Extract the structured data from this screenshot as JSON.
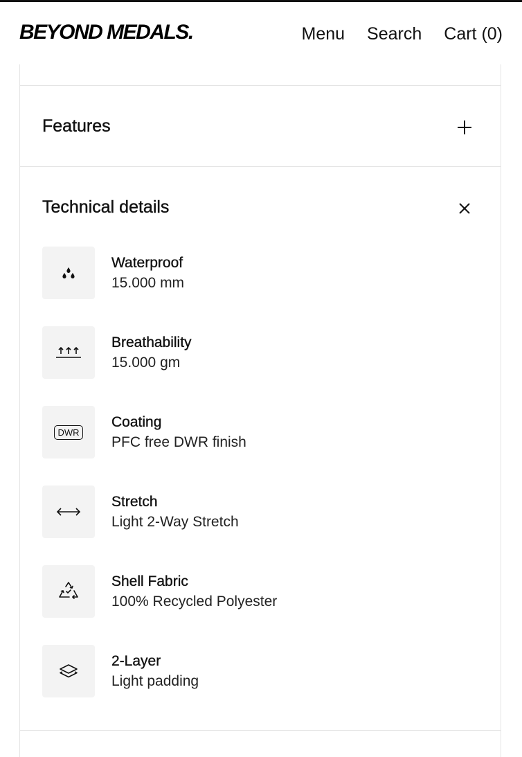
{
  "header": {
    "logo": "BEYOND MEDALS.",
    "nav": {
      "menu": "Menu",
      "search": "Search",
      "cart": "Cart (0)"
    }
  },
  "sections": {
    "features": {
      "title": "Features",
      "toggle_icon": "plus-icon"
    },
    "technical": {
      "title": "Technical details",
      "toggle_icon": "close-icon"
    }
  },
  "specs": [
    {
      "icon": "water-drops-icon",
      "title": "Waterproof",
      "value": "15.000 mm"
    },
    {
      "icon": "breathability-arrows-icon",
      "title": "Breathability",
      "value": "15.000 gm"
    },
    {
      "icon": "dwr-icon",
      "icon_text": "DWR",
      "title": "Coating",
      "value": "PFC free DWR finish"
    },
    {
      "icon": "horizontal-arrows-icon",
      "title": "Stretch",
      "value": "Light 2-Way Stretch"
    },
    {
      "icon": "recycle-icon",
      "title": "Shell Fabric",
      "value": "100% Recycled Polyester"
    },
    {
      "icon": "layers-icon",
      "title": "2-Layer",
      "value": "Light padding"
    }
  ],
  "colors": {
    "text": "#111111",
    "icon_bg": "#f3f3f3",
    "divider": "#e4e4e4"
  }
}
